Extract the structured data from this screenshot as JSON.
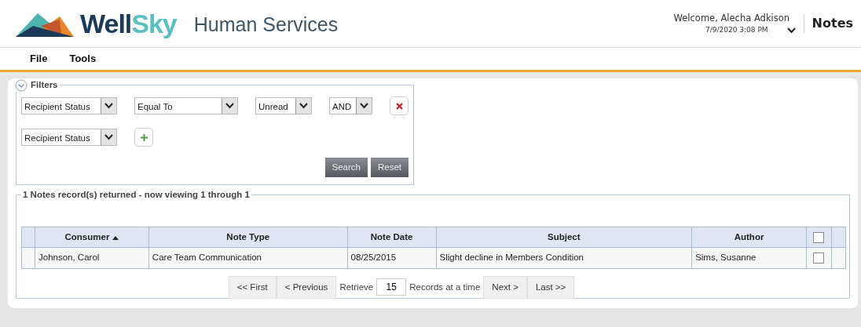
{
  "header": {
    "logo": {
      "part_1": "Well",
      "part_2": "Sky"
    },
    "product": "Human Services",
    "welcome": "Welcome, Alecha Adkison",
    "datetime": "7/9/2020 3:08 PM",
    "section": "Notes"
  },
  "menu": [
    {
      "label": "File"
    },
    {
      "label": "Tools"
    }
  ],
  "filters": {
    "title": "Filters",
    "expanded": true,
    "rows": [
      {
        "kind": "condition",
        "selects": [
          "Recipient Status",
          "Equal To",
          "Unread",
          "AND"
        ]
      },
      {
        "kind": "new",
        "selects": [
          "Recipient Status"
        ]
      }
    ],
    "buttons": [
      "Search",
      "Reset"
    ]
  },
  "results": {
    "title": "1 Notes record(s) returned - now viewing 1 through 1",
    "columns": [
      {
        "label": "Consumer",
        "sorted": true
      },
      {
        "label": "Note Type",
        "sorted": false
      },
      {
        "label": "Note Date",
        "sorted": false
      },
      {
        "label": "Subject",
        "sorted": false
      },
      {
        "label": "Author",
        "sorted": false
      }
    ],
    "header_checked": false,
    "rows": [
      {
        "cells": [
          "Johnson, Carol",
          "Care Team Communication",
          "08/25/2015",
          "Slight decline in Members Condition",
          "Sims, Susanne"
        ],
        "checked": false
      }
    ],
    "pager": {
      "buttons_before": [
        "<< First",
        "< Previous"
      ],
      "retrieve_label": "Retrieve",
      "page_size": "15",
      "suffix": "Records at a time",
      "buttons_after": [
        "Next >",
        "Last >>"
      ]
    }
  }
}
